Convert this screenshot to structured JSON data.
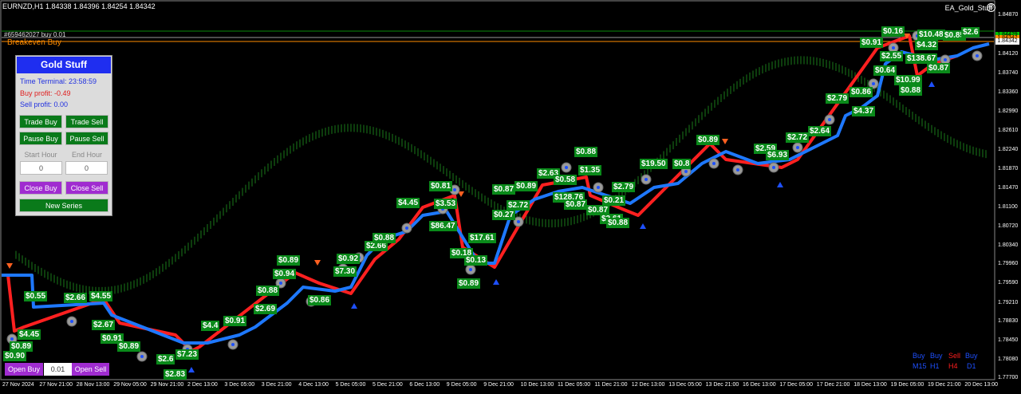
{
  "header": {
    "symbol_line": "EURNZD,H1  1.84338 1.84396 1.84254 1.84342",
    "ea_name": "EA_Gold_Stuff",
    "smiley": "☺"
  },
  "order_lines": {
    "buy_order_label": "#659462027 buy 0.01",
    "breakeven_label": "Breakeven Buy"
  },
  "panel": {
    "title": "Gold Stuff",
    "time_terminal": "Time Terminal: 23:58:59",
    "buy_profit": "Buy profit: -0.49",
    "sell_profit": "Sell profit: 0.00",
    "trade_buy": "Trade Buy",
    "trade_sell": "Trade Sell",
    "pause_buy": "Pause Buy",
    "pause_sell": "Pause Sell",
    "start_hour_label": "Start Hour",
    "end_hour_label": "End Hour",
    "start_hour_value": "0",
    "end_hour_value": "0",
    "close_buy": "Close Buy",
    "close_sell": "Close Sell",
    "new_series": "New Series"
  },
  "bottom_controls": {
    "open_buy": "Open Buy",
    "lot_value": "0.01",
    "open_sell": "Open Sell"
  },
  "price_axis": [
    "1.84870",
    "1.84120",
    "1.83740",
    "1.83360",
    "1.82990",
    "1.82610",
    "1.82240",
    "1.81870",
    "1.81470",
    "1.81100",
    "1.80720",
    "1.80340",
    "1.79960",
    "1.79590",
    "1.79210",
    "1.78830",
    "1.78450",
    "1.78080",
    "1.77700"
  ],
  "price_tags": {
    "current_green": "1.84429",
    "current_orange": "1.84342",
    "bid": "1.84342"
  },
  "time_axis": [
    "27 Nov 2024",
    "27 Nov 21:00",
    "28 Nov 13:00",
    "29 Nov 05:00",
    "29 Nov 21:00",
    "2 Dec 13:00",
    "3 Dec 05:00",
    "3 Dec 21:00",
    "4 Dec 13:00",
    "5 Dec 05:00",
    "5 Dec 21:00",
    "6 Dec 13:00",
    "9 Dec 05:00",
    "9 Dec 21:00",
    "10 Dec 13:00",
    "11 Dec 05:00",
    "11 Dec 21:00",
    "12 Dec 13:00",
    "13 Dec 05:00",
    "13 Dec 21:00",
    "16 Dec 13:00",
    "17 Dec 05:00",
    "17 Dec 21:00",
    "18 Dec 13:00",
    "19 Dec 05:00",
    "19 Dec 21:00",
    "20 Dec 13:00"
  ],
  "timeframe_legend": {
    "row1": [
      "Buy",
      "Buy",
      "Sell",
      "Buy"
    ],
    "row2": [
      "M15",
      "H1",
      "H4",
      "D1"
    ],
    "colors": {
      "buy": "#1e50ff",
      "sell": "#ff1e1e",
      "m15": "#1e50ff",
      "h1": "#1e50ff",
      "h4": "#ff1e1e",
      "d1": "#1e50ff"
    }
  },
  "profit_flags": [
    "$0.89",
    "$0.90",
    "$4.45",
    "$0.89",
    "$2.66",
    "$4.55",
    "$2.67",
    "$0.91",
    "$0.89",
    "$2.6",
    "$7.23",
    "$2.83",
    "$4.4",
    "$0.91",
    "$0.88",
    "$2.69",
    "$0.89",
    "$0.94",
    "$0.86",
    "$7.30",
    "$0.92",
    "$2.66",
    "$0.88",
    "$4.45",
    "$3.53",
    "$86.47",
    "$0.81",
    "$0.18",
    "$0.13",
    "$17.61",
    "$0.89",
    "$0.87",
    "$2.72",
    "$0.27",
    "$0.89",
    "$2.63",
    "$0.58",
    "$128.76",
    "$0.87",
    "$0.88",
    "$1.35",
    "$0.87",
    "$0.21",
    "$2.61",
    "$0.88",
    "$2.79",
    "$19.50",
    "$0.8",
    "$0.89",
    "$2.59",
    "$6.93",
    "$2.72",
    "$2.64",
    "$2.79",
    "$0.86",
    "$4.37",
    "$0.16",
    "$0.91",
    "$2.55",
    "$0.64",
    "$138.67",
    "$10.99",
    "$0.88",
    "$0.87",
    "$10.48",
    "$0.85",
    "$2.6",
    "$4.32",
    "$0.55"
  ],
  "colors": {
    "background": "#000000",
    "buy_line": "#1e78ff",
    "sell_line": "#ff2020",
    "flag_bg": "#0a8a1a",
    "panel_title": "#1f2ef0"
  }
}
